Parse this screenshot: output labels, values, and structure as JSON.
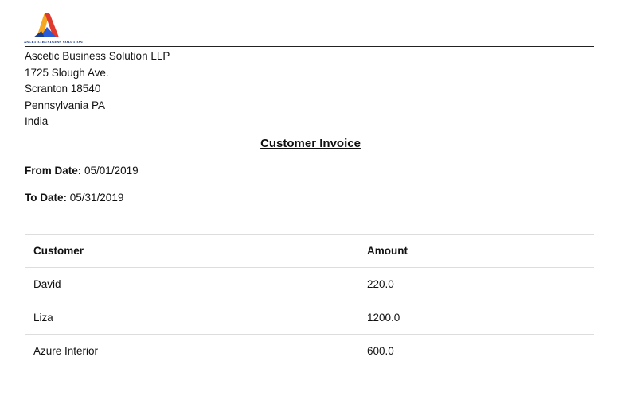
{
  "company": {
    "logo_text": "ASCETIC BUSINESS SOLUTION",
    "name": "Ascetic Business Solution LLP",
    "street": "1725 Slough Ave.",
    "city_zip": "Scranton 18540",
    "state": "Pennsylvania PA",
    "country": "India",
    "colors": {
      "orange": "#f5a623",
      "red": "#e03a2e",
      "blue": "#2a5bd7"
    }
  },
  "invoice": {
    "title": "Customer Invoice",
    "from_label": "From Date:",
    "from_value": "05/01/2019",
    "to_label": "To Date:",
    "to_value": "05/31/2019"
  },
  "table": {
    "headers": {
      "customer": "Customer",
      "amount": "Amount"
    },
    "rows": [
      {
        "customer": "David",
        "amount": "220.0"
      },
      {
        "customer": "Liza",
        "amount": "1200.0"
      },
      {
        "customer": "Azure Interior",
        "amount": "600.0"
      }
    ]
  }
}
